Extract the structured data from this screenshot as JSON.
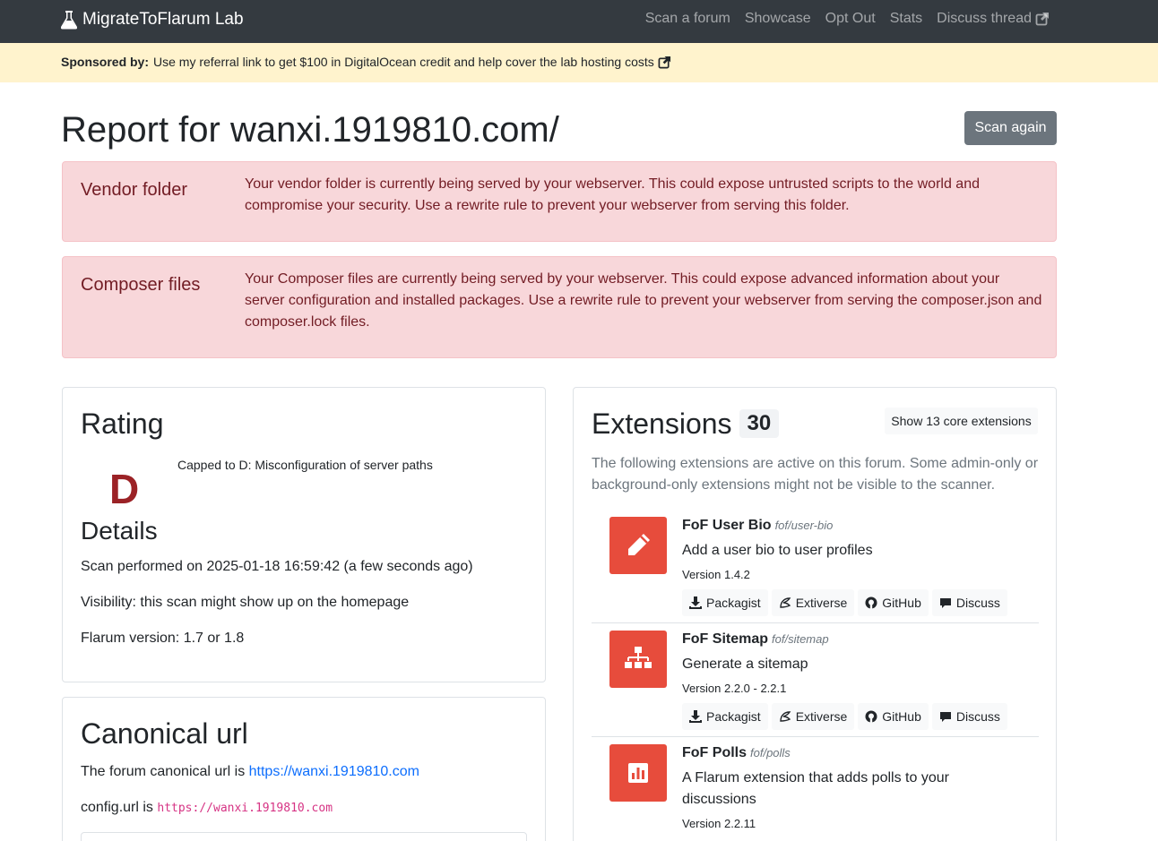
{
  "navbar": {
    "brand": "MigrateToFlarum Lab",
    "links": [
      "Scan a forum",
      "Showcase",
      "Opt Out",
      "Stats",
      "Discuss thread"
    ]
  },
  "sponsor": {
    "label": "Sponsored by:",
    "text": "Use my referral link to get $100 in DigitalOcean credit and help cover the lab hosting costs"
  },
  "report": {
    "title": "Report for wanxi.1919810.com/",
    "scan_again": "Scan again"
  },
  "alerts": [
    {
      "title": "Vendor folder",
      "body": "Your vendor folder is currently being served by your webserver. This could expose untrusted scripts to the world and compromise your security. Use a rewrite rule to prevent your webserver from serving this folder."
    },
    {
      "title": "Composer files",
      "body": "Your Composer files are currently being served by your webserver. This could expose advanced information about your server configuration and installed packages. Use a rewrite rule to prevent your webserver from serving the composer.json and composer.lock files."
    }
  ],
  "rating": {
    "heading": "Rating",
    "grade": "D",
    "capped": "Capped to D: Misconfiguration of server paths",
    "details_heading": "Details",
    "scan_performed": "Scan performed on 2025-01-18 16:59:42 (a few seconds ago)",
    "visibility": "Visibility: this scan might show up on the homepage",
    "flarum_version": "Flarum version: 1.7 or 1.8"
  },
  "canonical": {
    "heading": "Canonical url",
    "text": "The forum canonical url is",
    "url": "https://wanxi.1919810.com",
    "config_label": "config.url is",
    "config_value": "https://wanxi.1919810.com"
  },
  "extensions": {
    "heading": "Extensions",
    "count": "30",
    "show_core": "Show 13 core extensions",
    "description": "The following extensions are active on this forum. Some admin-only or background-only extensions might not be visible to the scanner.",
    "link_labels": [
      "Packagist",
      "Extiverse",
      "GitHub",
      "Discuss"
    ],
    "items": [
      {
        "name": "FoF User Bio",
        "package": "fof/user-bio",
        "description": "Add a user bio to user profiles",
        "version": "Version 1.4.2",
        "icon": "pencil-icon"
      },
      {
        "name": "FoF Sitemap",
        "package": "fof/sitemap",
        "description": "Generate a sitemap",
        "version": "Version 2.2.0 - 2.2.1",
        "icon": "sitemap-icon"
      },
      {
        "name": "FoF Polls",
        "package": "fof/polls",
        "description": "A Flarum extension that adds polls to your discussions",
        "version": "Version 2.2.11",
        "icon": "poll-icon"
      }
    ]
  },
  "colors": {
    "navbar": "#343a40",
    "sponsor_bg": "#fff3cd",
    "alert_bg": "#f8d7da",
    "alert_text": "#721c24",
    "grade": "#9b2226",
    "ext_icon_bg": "#e74c3c",
    "link": "#0d6efd"
  }
}
